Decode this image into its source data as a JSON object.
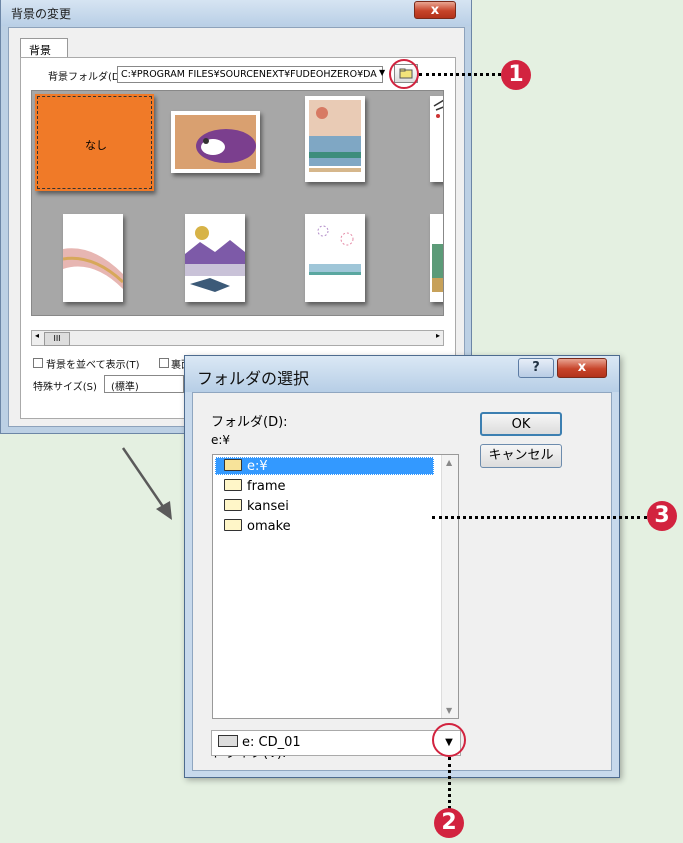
{
  "bg_window": {
    "title": "背景の変更",
    "close": "x",
    "tab": "背景",
    "folder_label": "背景フォルダ(D)",
    "folder_path": "C:¥PROGRAM FILES¥SOURCENEXT¥FUDEOHZERO¥DA",
    "first_thumb_label": "なし",
    "scroll_thumb": "III",
    "check1_label": "背景を並べて表示(T)",
    "check2_label": "裏面",
    "size_label": "特殊サイズ(S)",
    "size_value": "(標準)"
  },
  "folder_dialog": {
    "title": "フォルダの選択",
    "help": "?",
    "close": "x",
    "folder_label": "フォルダ(D):",
    "current_path": "e:¥",
    "ok": "OK",
    "cancel": "キャンセル",
    "folders": [
      "e:¥",
      "frame",
      "kansei",
      "omake"
    ],
    "drive_label": "ドライブ(V):",
    "drive_value": "e: CD_01"
  },
  "callouts": [
    "1",
    "2",
    "3"
  ],
  "colors": {
    "callout": "#d2233f",
    "selection": "#3399ff",
    "none_thumb": "#f07a28"
  }
}
